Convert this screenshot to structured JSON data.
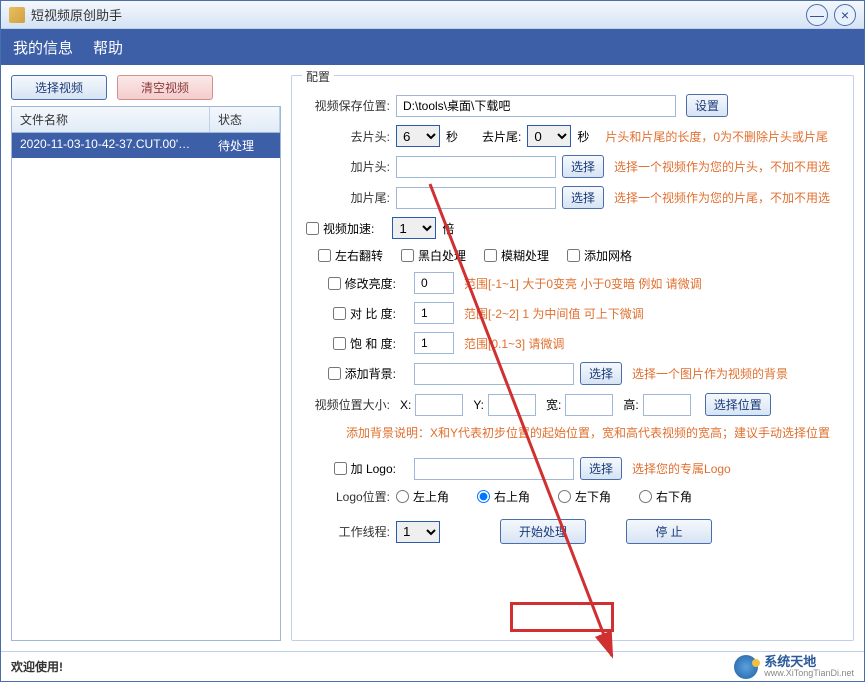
{
  "window": {
    "title": "短视频原创助手"
  },
  "menu": {
    "my_info": "我的信息",
    "help": "帮助"
  },
  "left": {
    "select_btn": "选择视频",
    "clear_btn": "清空视频",
    "col_name": "文件名称",
    "col_status": "状态",
    "rows": [
      {
        "name": "2020-11-03-10-42-37.CUT.00'…",
        "status": "待处理"
      }
    ]
  },
  "config": {
    "title": "配置",
    "save_path_label": "视频保存位置:",
    "save_path": "D:\\tools\\桌面\\下载吧",
    "set_btn": "设置",
    "trim_head_label": "去片头:",
    "trim_head_value": "6",
    "seconds": "秒",
    "trim_tail_label": "去片尾:",
    "trim_tail_value": "0",
    "trim_hint": "片头和片尾的长度，0为不删除片头或片尾",
    "add_head_label": "加片头:",
    "add_head_value": "",
    "select_btn": "选择",
    "add_head_hint": "选择一个视频作为您的片头，不加不用选",
    "add_tail_label": "加片尾:",
    "add_tail_value": "",
    "add_tail_hint": "选择一个视频作为您的片尾，不加不用选",
    "speed_label": "视频加速:",
    "speed_value": "1",
    "speed_suffix": "倍",
    "flip_label": "左右翻转",
    "bw_label": "黑白处理",
    "blur_label": "模糊处理",
    "grid_label": "添加网格",
    "brightness_label": "修改亮度:",
    "brightness_value": "0",
    "brightness_hint": "范围[-1~1]   大于0变亮 小于0变暗  例如 请微调",
    "contrast_label": "对 比 度:",
    "contrast_value": "1",
    "contrast_hint": "范围[-2~2]   1 为中间值  可上下微调",
    "saturation_label": "饱 和 度:",
    "saturation_value": "1",
    "saturation_hint": "范围[0.1~3]   请微调",
    "bg_label": "添加背景:",
    "bg_value": "",
    "bg_hint": "选择一个图片作为视频的背景",
    "pos_label": "视频位置大小:",
    "x_label": "X:",
    "y_label": "Y:",
    "w_label": "宽:",
    "h_label": "高:",
    "pos_btn": "选择位置",
    "pos_hint": "添加背景说明：X和Y代表初步位置的起始位置，宽和高代表视频的宽高；建议手动选择位置",
    "logo_label": "加 Logo:",
    "logo_value": "",
    "logo_hint": "选择您的专属Logo",
    "logo_pos_label": "Logo位置:",
    "logo_pos_tl": "左上角",
    "logo_pos_tr": "右上角",
    "logo_pos_bl": "左下角",
    "logo_pos_br": "右下角",
    "threads_label": "工作线程:",
    "threads_value": "1",
    "start_btn": "开始处理",
    "stop_btn": "停    止"
  },
  "statusbar": {
    "text": "欢迎使用!",
    "brand_main": "系统天地",
    "brand_sub": "www.XiTongTianDi.net"
  }
}
